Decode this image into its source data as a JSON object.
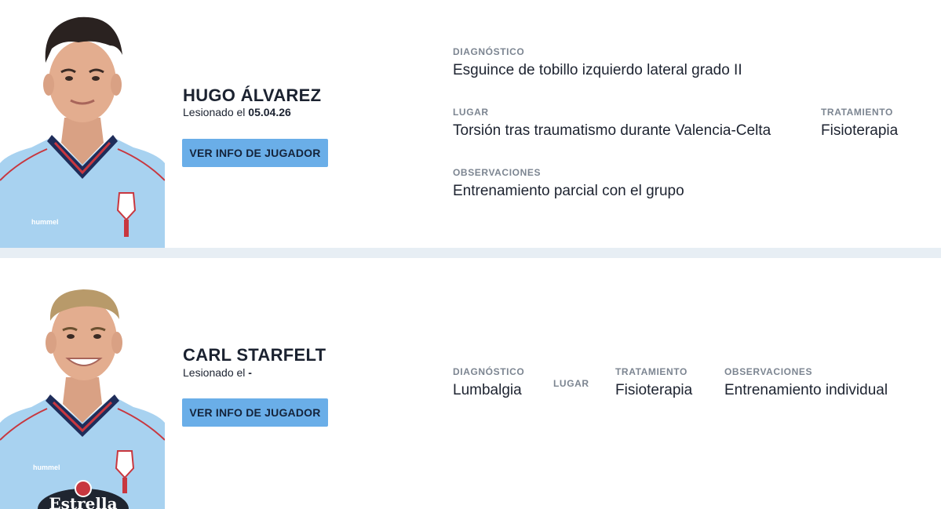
{
  "players": [
    {
      "name": "HUGO ÁLVAREZ",
      "injured_prefix": "Lesionado el ",
      "injured_date": "05.04.26",
      "button_label": "VER INFO DE JUGADOR",
      "diagnosis_label": "DIAGNÓSTICO",
      "diagnosis": "Esguince de tobillo izquierdo lateral grado II",
      "place_label": "LUGAR",
      "place": "Torsión tras traumatismo durante Valencia-Celta",
      "treatment_label": "TRATAMIENTO",
      "treatment": "Fisioterapia",
      "observations_label": "OBSERVACIONES",
      "observations": "Entrenamiento parcial con el grupo"
    },
    {
      "name": "CARL STARFELT",
      "injured_prefix": "Lesionado el ",
      "injured_date": "-",
      "button_label": "VER INFO DE JUGADOR",
      "diagnosis_label": "DIAGNÓSTICO",
      "diagnosis": "Lumbalgia",
      "place_label": "LUGAR",
      "place": "",
      "treatment_label": "TRATAMIENTO",
      "treatment": "Fisioterapia",
      "observations_label": "OBSERVACIONES",
      "observations": "Entrenamiento individual"
    }
  ],
  "colors": {
    "button_bg": "#6aaee8",
    "jersey": "#a8d2f0",
    "separator": "#e7eef4",
    "label": "#7c8591"
  },
  "sponsor_text": "Estrella",
  "kit_brand_text": "hummel"
}
